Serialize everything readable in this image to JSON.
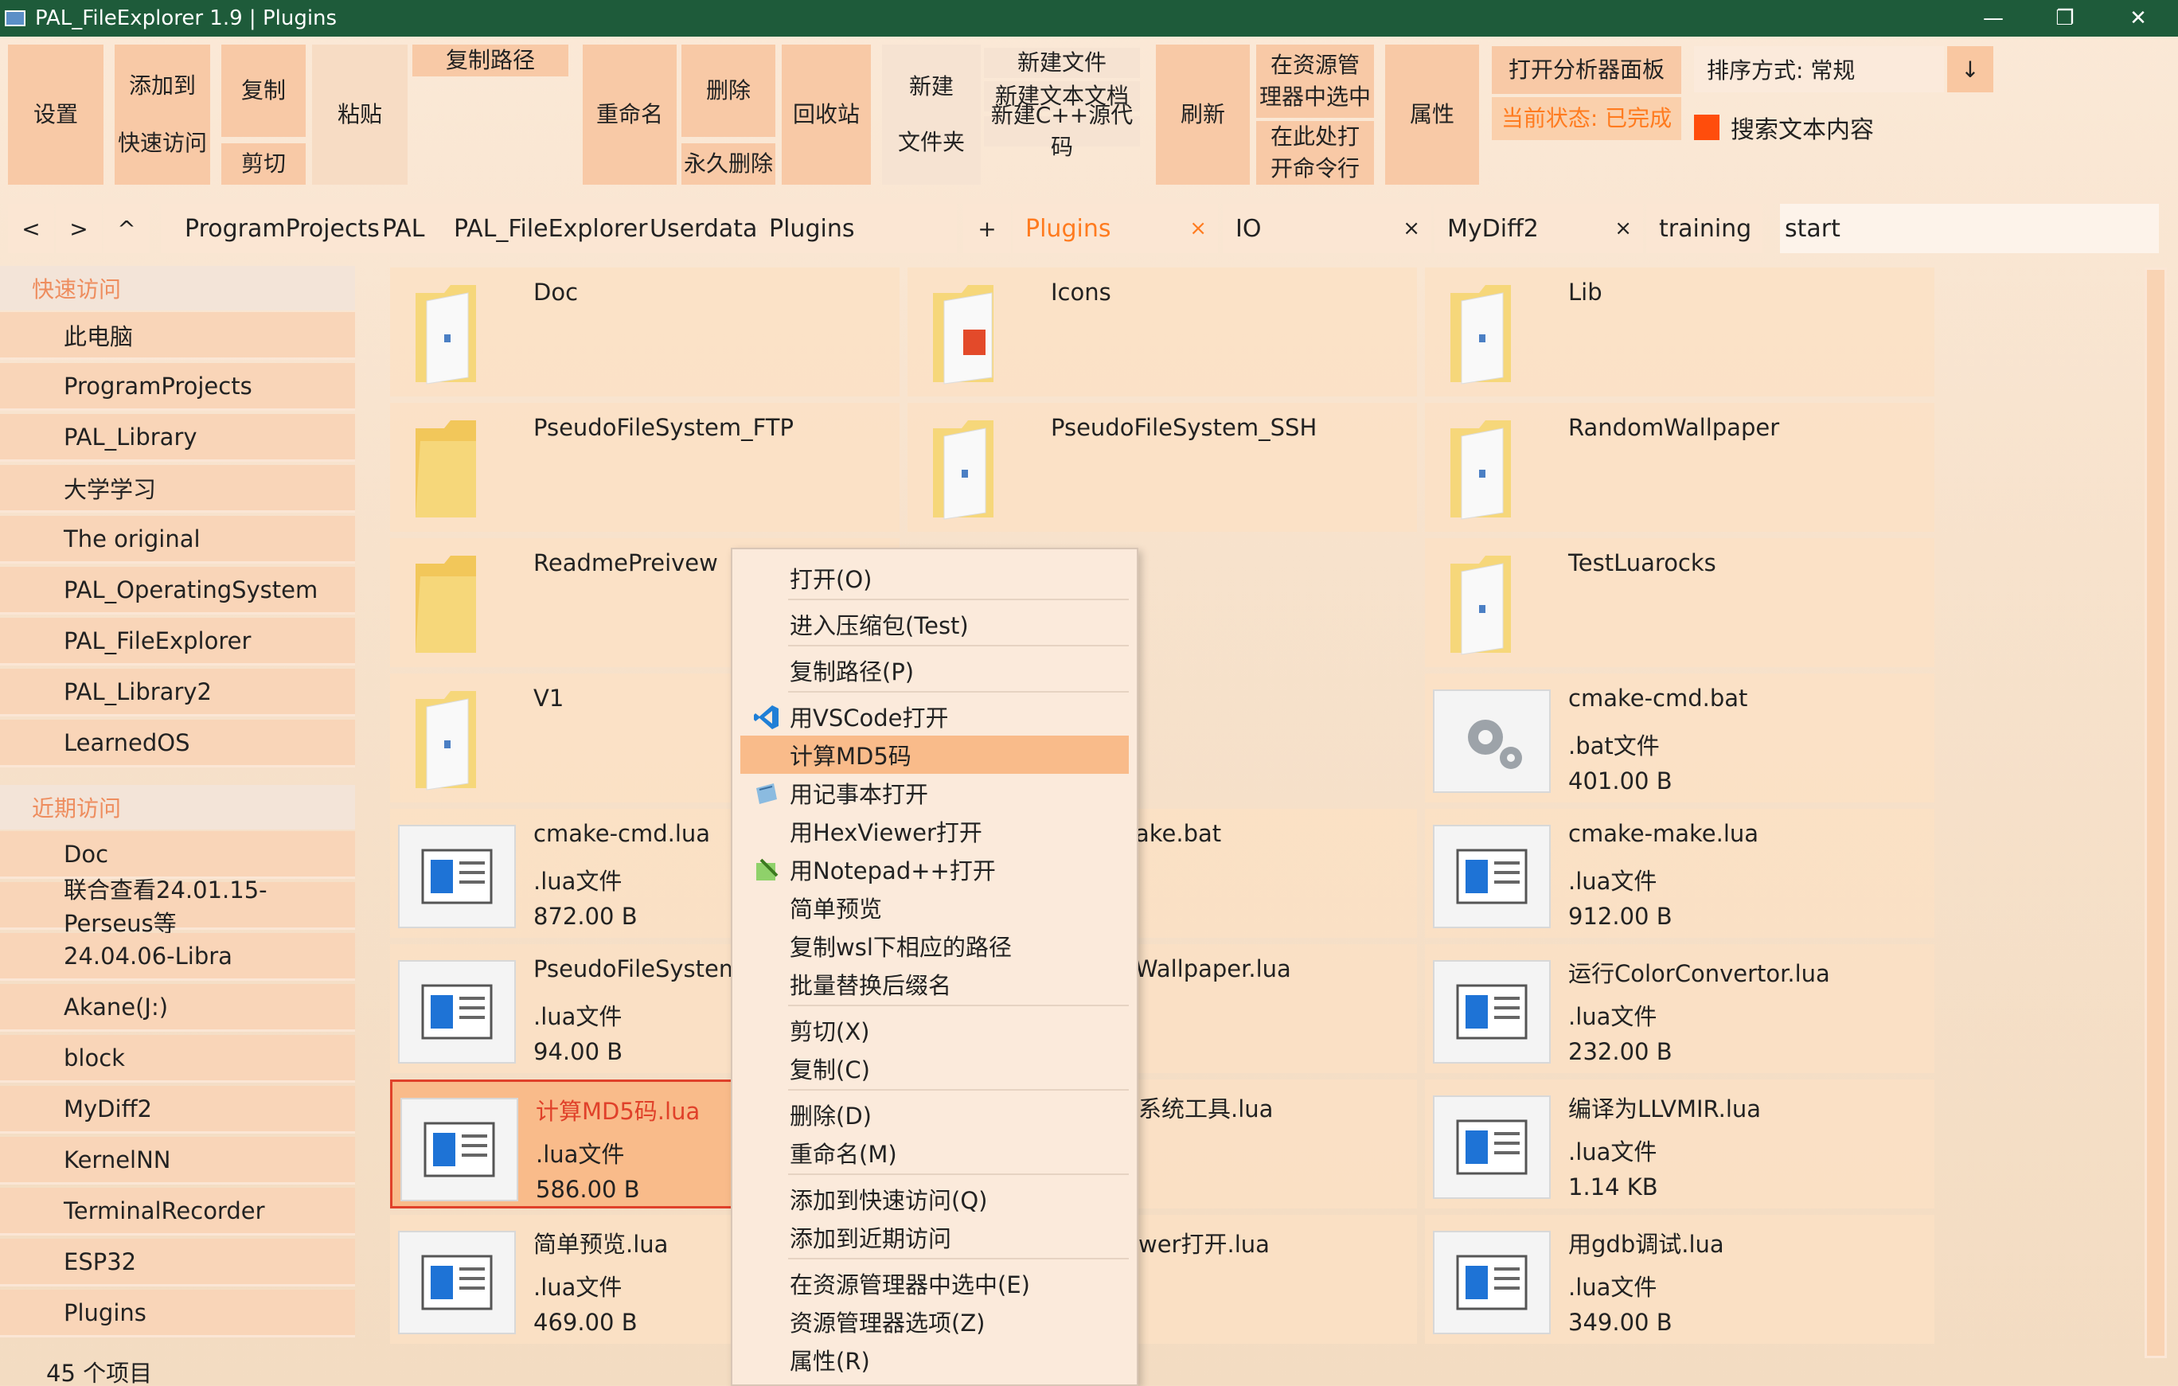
{
  "window": {
    "title": "PAL_FileExplorer 1.9 | Plugins",
    "min": "—",
    "restore": "❐",
    "close": "✕"
  },
  "toolbar": {
    "settings": "设置",
    "add_to": "添加到",
    "quick_access": "快速访问",
    "copy": "复制",
    "cut": "剪切",
    "paste": "粘贴",
    "copy_path": "复制路径",
    "rename": "重命名",
    "delete": "删除",
    "perm_delete": "永久删除",
    "recycle": "回收站",
    "new_folder_1": "新建",
    "new_folder_2": "文件夹",
    "new_file": "新建文件",
    "new_text": "新建文本文档",
    "new_cpp": "新建C++源代码",
    "refresh": "刷新",
    "select_in_explorer_1": "在资源管",
    "select_in_explorer_2": "理器中选中",
    "open_cmd_1": "在此处打",
    "open_cmd_2": "开命令行",
    "properties": "属性",
    "open_analyzer": "打开分析器面板",
    "status": "当前状态: 已完成",
    "sort": "排序方式: 常规",
    "sort_dir": "↓",
    "search_text": "搜索文本内容"
  },
  "nav": {
    "back": "<",
    "forward": ">",
    "up": "^",
    "add_tab": "+"
  },
  "breadcrumb": [
    "ProgramProjects",
    "PAL",
    "PAL_FileExplorer",
    "Userdata",
    "Plugins"
  ],
  "tabs": [
    {
      "label": "Plugins",
      "close": "×",
      "active": true
    },
    {
      "label": "IO",
      "close": "×"
    },
    {
      "label": "MyDiff2",
      "close": "×"
    },
    {
      "label": "training"
    }
  ],
  "search": {
    "value": "start"
  },
  "sidebar": {
    "quick_head": "快速访问",
    "quick": [
      "此电脑",
      "ProgramProjects",
      "PAL_Library",
      "大学学习",
      "The original",
      "PAL_OperatingSystem",
      "PAL_FileExplorer",
      "PAL_Library2",
      "LearnedOS"
    ],
    "recent_head": "近期访问",
    "recent": [
      "Doc",
      "联合查看24.01.15-Perseus等",
      "24.04.06-Libra",
      "Akane(J:)",
      "block",
      "MyDiff2",
      "KernelNN",
      "TerminalRecorder",
      "ESP32",
      "Plugins"
    ]
  },
  "status": "45 个项目",
  "files": [
    {
      "name": "Doc"
    },
    {
      "name": "Icons"
    },
    {
      "name": "Lib"
    },
    {
      "name": "PseudoFileSystem_FTP"
    },
    {
      "name": "PseudoFileSystem_SSH"
    },
    {
      "name": "RandomWallpaper"
    },
    {
      "name": "ReadmePreivew"
    },
    {
      "name": "TestLuarocks"
    },
    {
      "name": "V1"
    },
    {
      "name": "cmake-cmd.bat",
      "type": ".bat文件",
      "size": "401.00 B"
    },
    {
      "name": "cmake-cmd.lua",
      "type": ".lua文件",
      "size": "872.00 B"
    },
    {
      "name": "ake.bat"
    },
    {
      "name": "cmake-make.lua",
      "type": ".lua文件",
      "size": "912.00 B"
    },
    {
      "name": "PseudoFileSystem_S",
      "type": ".lua文件",
      "size": "94.00 B"
    },
    {
      "name": "Wallpaper.lua"
    },
    {
      "name": "运行ColorConvertor.lua",
      "type": ".lua文件",
      "size": "232.00 B"
    },
    {
      "name": "计算MD5码.lua",
      "type": ".lua文件",
      "size": "586.00 B"
    },
    {
      "name": "系统工具.lua"
    },
    {
      "name": "编译为LLVMIR.lua",
      "type": ".lua文件",
      "size": "1.14 KB"
    },
    {
      "name": "简单预览.lua",
      "type": ".lua文件",
      "size": "469.00 B"
    },
    {
      "name": "wer打开.lua"
    },
    {
      "name": "用gdb调试.lua",
      "type": ".lua文件",
      "size": "349.00 B"
    }
  ],
  "menu": [
    "打开(O)",
    "进入压缩包(Test)",
    "复制路径(P)",
    "用VSCode打开",
    "计算MD5码",
    "用记事本打开",
    "用HexViewer打开",
    "用Notepad++打开",
    "简单预览",
    "复制wsl下相应的路径",
    "批量替换后缀名",
    "剪切(X)",
    "复制(C)",
    "删除(D)",
    "重命名(M)",
    "添加到快速访问(Q)",
    "添加到近期访问",
    "在资源管理器中选中(E)",
    "资源管理器选项(Z)",
    "属性(R)"
  ],
  "colors": {
    "titlebar": "#1e5b3a",
    "button": "#f8c9a6",
    "highlight": "#f9bb8a",
    "accent_text": "#ff7b1f",
    "selected_border": "#e0412a"
  }
}
